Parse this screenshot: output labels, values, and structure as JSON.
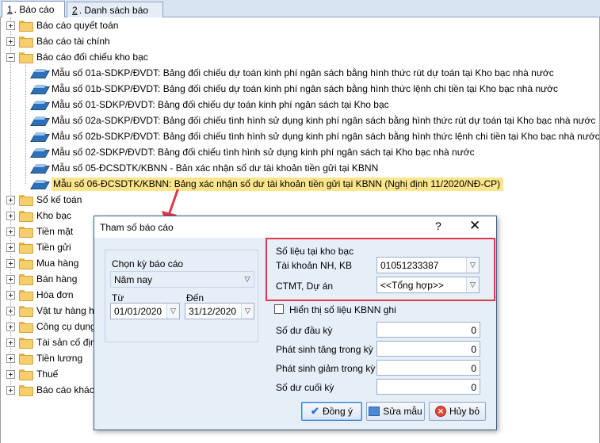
{
  "tabs": [
    {
      "num": "1",
      "label": ". Báo cáo"
    },
    {
      "num": "2",
      "label": ". Danh sách báo cáo"
    }
  ],
  "tree": {
    "top_folders": [
      "Báo cáo quyết toán",
      "Báo cáo tài chính"
    ],
    "open_folder": "Báo cáo đối chiếu kho bạc",
    "reports": [
      "Mẫu số 01a-SDKP/ĐVDT: Bảng đối chiếu dự toán kinh phí ngân sách bằng hình thức rút dự toán tại Kho bạc nhà nước",
      "Mẫu số 01b-SDKP/ĐVDT: Bảng đối chiếu dự toán kinh phí ngân sách bằng hình thức lệnh chi tiền tại Kho bạc nhà nước",
      "Mẫu số 01-SDKP/ĐVDT: Bảng đối chiếu dự toán kinh phí ngân sách tại Kho bạc",
      "Mẫu số 02a-SDKP/ĐVDT: Bảng đối chiếu tình hình sử dụng kinh phí ngân sách bằng hình thức rút dự toán tại Kho bạc nhà nước",
      "Mẫu số 02b-SDKP/ĐVDT: Bảng đối chiếu tình hình sử dụng kinh phí ngân sách bằng hình thức lệnh chi tiền tại Kho bạc nhà nước",
      "Mẫu số 02-SDKP/ĐVDT: Bảng đối chiếu tình hình sử dụng kinh phí ngân sách tại Kho bạc nhà nước",
      "Mẫu số 05-ĐCSDTK/KBNN - Bản xác nhận số dư tài khoản tiền gửi tại KBNN",
      "Mẫu số 06-ĐCSDTK/KBNN: Bảng xác nhận số dư tài khoản tiền gửi tại KBNN (Nghị định 11/2020/NĐ-CP)"
    ],
    "bottom_folders": [
      "Sổ kế toán",
      "Kho bạc",
      "Tiền mặt",
      "Tiền gửi",
      "Mua hàng",
      "Bán hàng",
      "Hóa đơn",
      "Vật tư hàng hóa",
      "Công cụ dụng cụ",
      "Tài sản cố định",
      "Tiền lương",
      "Thuế",
      "Báo cáo khác"
    ]
  },
  "dialog": {
    "title": "Tham số báo cáo",
    "help": "?",
    "close": "✕",
    "period_label": "Chọn kỳ báo cáo",
    "period_value": "Năm nay",
    "from_label": "Từ",
    "from_value": "01/01/2020",
    "to_label": "Đến",
    "to_value": "31/12/2020",
    "kb_group_label": "Số liệu tại kho bạc",
    "account_label": "Tài khoản NH, KB",
    "account_value": "01051233387",
    "ctmt_label": "CTMT, Dự án",
    "ctmt_value": "<<Tổng hợp>>",
    "show_kbnn_label": "Hiển thị số liệu KBNN ghi",
    "fields": [
      {
        "label": "Số dư đầu kỳ",
        "value": "0"
      },
      {
        "label": "Phát sinh tăng trong kỳ",
        "value": "0"
      },
      {
        "label": "Phát sinh giảm trong kỳ",
        "value": "0"
      },
      {
        "label": "Số dư cuối kỳ",
        "value": "0"
      }
    ],
    "btn_ok": "Đồng ý",
    "btn_edit": "Sửa mẫu",
    "btn_cancel": "Hủy bỏ"
  },
  "colors": {
    "highlight": "#fce58a",
    "annotation_red": "#e2374a",
    "dialog_bg": "#e6eef8"
  }
}
